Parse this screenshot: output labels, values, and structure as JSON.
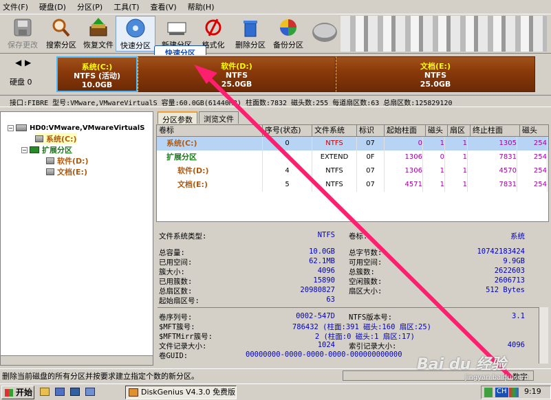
{
  "menubar": {
    "items": [
      "文件(F)",
      "硬盘(D)",
      "分区(P)",
      "工具(T)",
      "查看(V)",
      "帮助(H)"
    ]
  },
  "toolbar": {
    "buttons": [
      "保存更改",
      "搜索分区",
      "恢复文件",
      "快速分区",
      "新建分区",
      "格式化",
      "删除分区",
      "备份分区"
    ]
  },
  "tooltip": "快速分区",
  "diskbar": {
    "disk_label": "硬盘 0",
    "partitions": [
      {
        "name": "系统(C:)",
        "fs": "NTFS (活动)",
        "size": "10.0GB"
      },
      {
        "name": "软件(D:)",
        "fs": "NTFS",
        "size": "25.0GB"
      },
      {
        "name": "文档(E:)",
        "fs": "NTFS",
        "size": "25.0GB"
      }
    ]
  },
  "infobar": {
    "text": "接口:FIBRE  型号:VMware,VMwareVirtualS  容量:60.0GB(61440MB)  柱面数:7832  磁头数:255  每道扇区数:63  总扇区数:125829120"
  },
  "tree": {
    "disk": "HD0:VMware,VMwareVirtualS",
    "c": "系统(C:)",
    "ext": "扩展分区",
    "d": "软件(D:)",
    "e": "文档(E:)"
  },
  "tabs": [
    "分区参数",
    "浏览文件"
  ],
  "table": {
    "headers": [
      "卷标",
      "序号(状态)",
      "文件系统",
      "标识",
      "起始柱面",
      "磁头",
      "扇区",
      "终止柱面",
      "磁头"
    ],
    "rows": [
      {
        "label": "系统(C:)",
        "seq": "0",
        "fs": "NTFS",
        "id": "07",
        "start_cyl": "0",
        "head": "1",
        "sec": "1",
        "end_cyl": "1305",
        "end_head": "254"
      },
      {
        "label": "扩展分区",
        "seq": "",
        "fs": "EXTEND",
        "id": "0F",
        "start_cyl": "1306",
        "head": "0",
        "sec": "1",
        "end_cyl": "7831",
        "end_head": "254"
      },
      {
        "label": "软件(D:)",
        "seq": "4",
        "fs": "NTFS",
        "id": "07",
        "start_cyl": "1306",
        "head": "1",
        "sec": "1",
        "end_cyl": "4570",
        "end_head": "254"
      },
      {
        "label": "文档(E:)",
        "seq": "5",
        "fs": "NTFS",
        "id": "07",
        "start_cyl": "4571",
        "head": "1",
        "sec": "1",
        "end_cyl": "7831",
        "end_head": "254"
      }
    ]
  },
  "details": {
    "fstype_label": "文件系统类型:",
    "fstype": "NTFS",
    "vol_label": "卷标:",
    "vol": "系统",
    "left": [
      [
        "总容量:",
        "10.0GB"
      ],
      [
        "已用空间:",
        "62.1MB"
      ],
      [
        "簇大小:",
        "4096"
      ],
      [
        "已用簇数:",
        "15890"
      ],
      [
        "总扇区数:",
        "20980827"
      ],
      [
        "起始扇区号:",
        "63"
      ]
    ],
    "right": [
      [
        "总字节数:",
        "10742183424"
      ],
      [
        "可用空间:",
        "9.9GB"
      ],
      [
        "总簇数:",
        "2622603"
      ],
      [
        "空闲簇数:",
        "2606713"
      ],
      [
        "扇区大小:",
        "512 Bytes"
      ]
    ],
    "serial_label": "卷序列号:",
    "serial": "0002-547D",
    "ntfsver_label": "NTFS版本号:",
    "ntfsver": "3.1",
    "mft_label": "$MFT簇号:",
    "mft": "786432 (柱面:391 磁头:160 扇区:25)",
    "mftmirr_label": "$MFTMirr簇号:",
    "mftmirr": "2 (柱面:0 磁头:1 扇区:17)",
    "rec_label": "文件记录大小:",
    "rec": "1024",
    "idx_label": "索引记录大小:",
    "idx": "4096",
    "guid_label": "卷GUID:",
    "guid": "00000000-0000-0000-0000-000000000000"
  },
  "statusbar": {
    "text": "删除当前磁盘的所有分区并按要求建立指定个数的新分区。",
    "mode": "数字"
  },
  "taskbar": {
    "start": "开始",
    "app": "DiskGenius V4.3.0 免费版",
    "lang": "CH",
    "time": "9:19"
  },
  "watermark": {
    "line1": "Bai du 经验",
    "line2": "jingyan.baidu.com"
  },
  "colors": {
    "accent": "#1a4fb3",
    "arrow": "#ff1f6f",
    "partition": "#8b3a0a"
  }
}
